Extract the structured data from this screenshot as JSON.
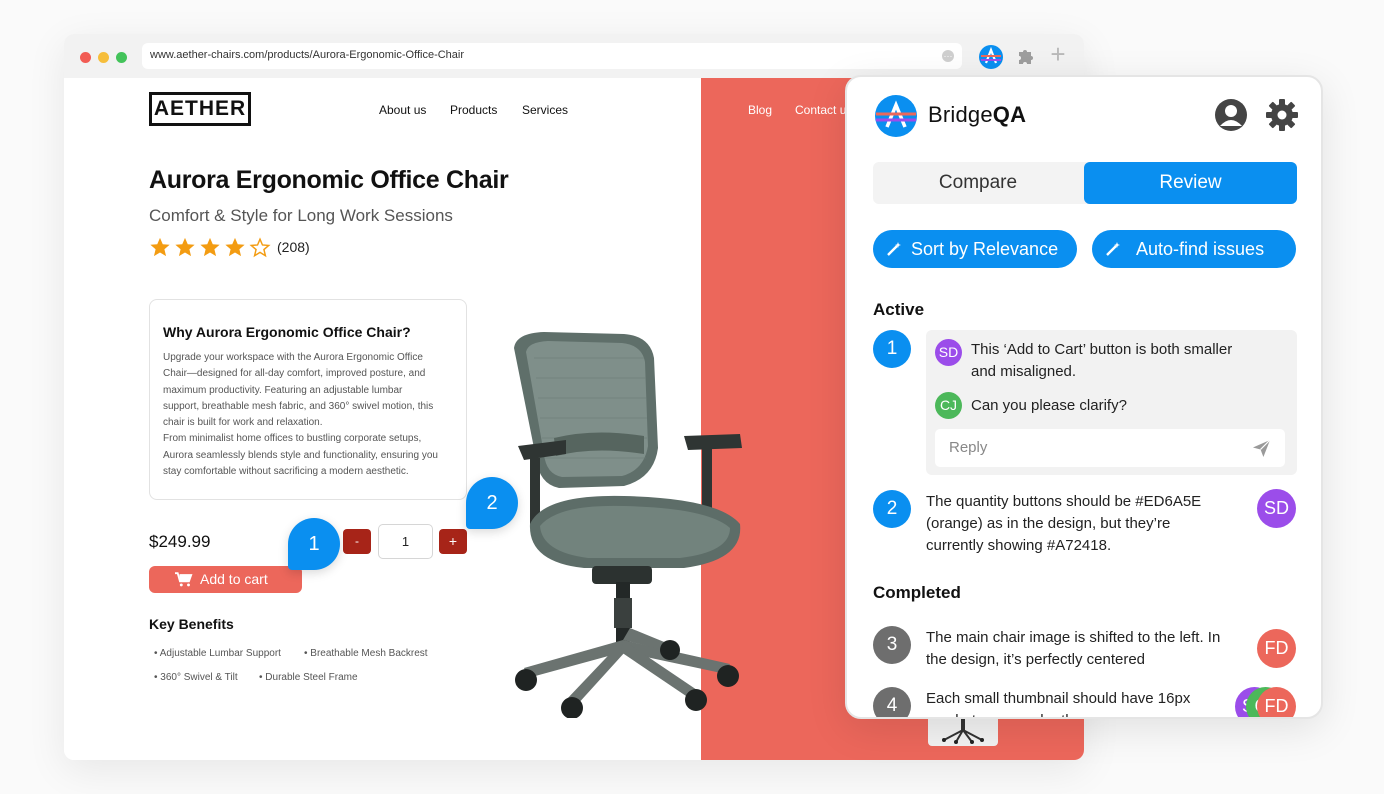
{
  "browser": {
    "url": "www.aether-chairs.com/products/Aurora-Ergonomic-Office-Chair",
    "new_tab": "+"
  },
  "site": {
    "logo": "AETHER",
    "nav": [
      "About us",
      "Products",
      "Services",
      "Blog",
      "Contact u"
    ],
    "product": {
      "title": "Aurora Ergonomic Office Chair",
      "subtitle": "Comfort & Style for Long Work Sessions",
      "rating": 4,
      "rating_max": 5,
      "review_count": "(208)",
      "why_title": "Why Aurora Ergonomic Office Chair?",
      "why_body": [
        "Upgrade your workspace with the Aurora Ergonomic Office",
        "Chair—designed for all-day comfort, improved posture, and",
        "maximum productivity. Featuring an adjustable lumbar",
        "support, breathable mesh fabric, and 360° swivel motion, this",
        "chair is built for work and relaxation.",
        "From minimalist home offices to bustling corporate setups,",
        "Aurora seamlessly blends style and functionality, ensuring you",
        "stay comfortable without sacrificing a modern aesthetic."
      ],
      "price": "$249.99",
      "qty_minus": "-",
      "qty_value": "1",
      "qty_plus": "+",
      "add_to_cart": "Add to cart",
      "key_benefits_title": "Key Benefits",
      "key_benefits": [
        "Adjustable Lumbar Support",
        "Breathable Mesh Backrest",
        "360° Swivel & Tilt",
        "Durable Steel Frame"
      ]
    },
    "colors": {
      "accent": "#ec675b",
      "qty_button": "#a72418",
      "pin": "#0a8ff0"
    }
  },
  "pins": [
    "1",
    "2"
  ],
  "panel": {
    "brand_prefix": "Bridge",
    "brand_suffix": "QA",
    "tabs": {
      "compare": "Compare",
      "review": "Review",
      "active": "review"
    },
    "actions": {
      "sort": "Sort by Relevance",
      "autofind": "Auto-find issues"
    },
    "active_title": "Active",
    "completed_title": "Completed",
    "issues": [
      {
        "number": "1",
        "comments": [
          {
            "initials": "SD",
            "lines": [
              "This ‘Add to Cart’ button is both smaller",
              "and misaligned."
            ]
          },
          {
            "initials": "CJ",
            "lines": [
              "Can you please clarify?"
            ]
          }
        ],
        "reply_placeholder": "Reply"
      },
      {
        "number": "2",
        "initials": "SD",
        "lines": [
          "The quantity buttons should be #ED6A5E",
          "(orange) as in the design, but they’re",
          "currently showing #A72418."
        ]
      },
      {
        "number": "3",
        "initials": "FD",
        "lines": [
          "The main chair image is shifted to the left. In",
          "the design, it’s perfectly centered"
        ]
      },
      {
        "number": "4",
        "initials": [
          "SD",
          "CJ",
          "FD"
        ],
        "lines": [
          "Each small thumbnail should have 16px",
          "gap between each other"
        ]
      }
    ],
    "colors": {
      "primary": "#0a8ff0",
      "completed": "#6e6e6e",
      "sd": "#9b4dea",
      "cj": "#4cb85a",
      "fd": "#ec675b"
    }
  }
}
